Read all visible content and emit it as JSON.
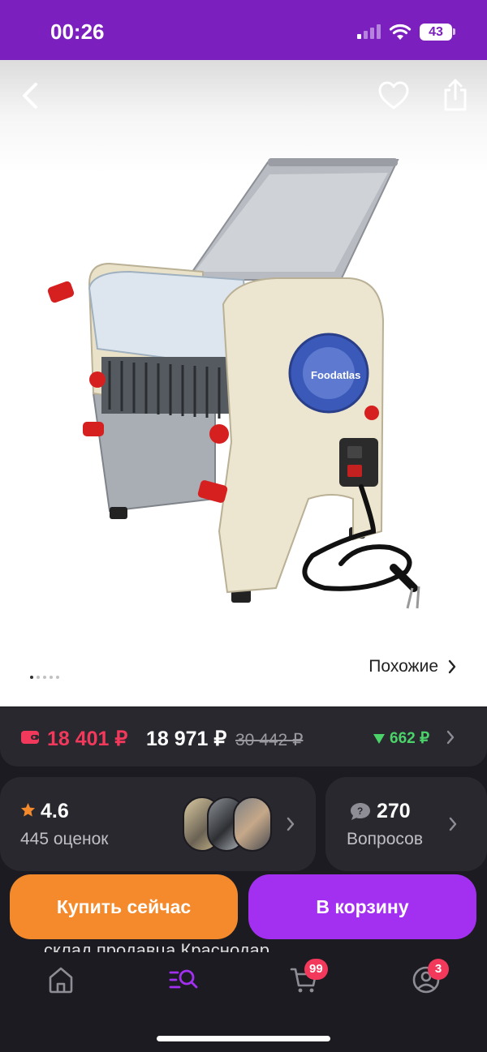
{
  "status_bar": {
    "time": "00:26",
    "battery": "43"
  },
  "gallery": {
    "similar_label": "Похожие",
    "dots_count": 5,
    "active_dot": 0
  },
  "price": {
    "card_price": "18 401 ₽",
    "regular_price": "18 971 ₽",
    "old_price": "30 442 ₽",
    "price_drop": "662 ₽"
  },
  "rating": {
    "value": "4.6",
    "count_label": "445 оценок"
  },
  "questions": {
    "count": "270",
    "label": "Вопросов"
  },
  "warehouse_text": "склад продавца Краснодар",
  "actions": {
    "buy_now": "Купить сейчас",
    "add_to_cart": "В корзину"
  },
  "bottom_nav": {
    "items": [
      {
        "icon": "home-icon"
      },
      {
        "icon": "catalog-search-icon",
        "active": true
      },
      {
        "icon": "cart-icon",
        "badge": "99"
      },
      {
        "icon": "profile-icon",
        "badge": "3"
      }
    ]
  },
  "colors": {
    "brand": "#7b1fbf",
    "price_red": "#f2395b",
    "buy_now": "#f48a2c",
    "add_to_cart": "#a330f0",
    "drop_green": "#4bd36a"
  }
}
